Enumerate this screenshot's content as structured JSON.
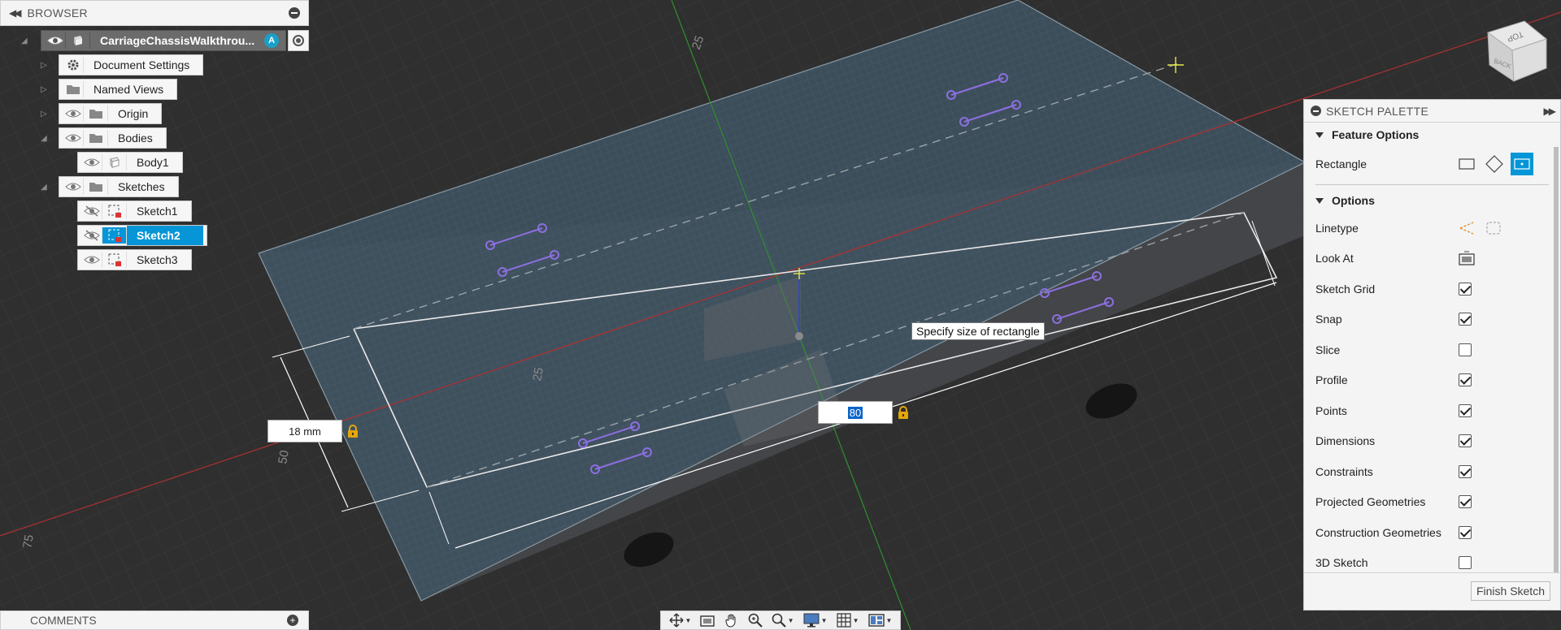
{
  "browser": {
    "title": "BROWSER",
    "root": {
      "label": "CarriageChassisWalkthrou...",
      "badge": "A"
    },
    "items": [
      {
        "label": "Document Settings"
      },
      {
        "label": "Named Views"
      },
      {
        "label": "Origin"
      },
      {
        "label": "Bodies"
      },
      {
        "label": "Body1"
      },
      {
        "label": "Sketches"
      },
      {
        "label": "Sketch1"
      },
      {
        "label": "Sketch2",
        "selected": true
      },
      {
        "label": "Sketch3"
      }
    ]
  },
  "comments": {
    "title": "COMMENTS"
  },
  "sketch_palette": {
    "title": "SKETCH PALETTE",
    "feature_options": {
      "title": "Feature Options",
      "rectangle_label": "Rectangle"
    },
    "options": {
      "title": "Options",
      "rows": [
        {
          "label": "Linetype"
        },
        {
          "label": "Look At"
        },
        {
          "label": "Sketch Grid",
          "checked": true
        },
        {
          "label": "Snap",
          "checked": true
        },
        {
          "label": "Slice",
          "checked": false
        },
        {
          "label": "Profile",
          "checked": true
        },
        {
          "label": "Points",
          "checked": true
        },
        {
          "label": "Dimensions",
          "checked": true
        },
        {
          "label": "Constraints",
          "checked": true
        },
        {
          "label": "Projected Geometries",
          "checked": true
        },
        {
          "label": "Construction Geometries",
          "checked": true
        },
        {
          "label": "3D Sketch",
          "checked": false
        }
      ]
    },
    "finish_label": "Finish Sketch"
  },
  "canvas": {
    "height_input": "18 mm",
    "width_input": "80",
    "tooltip": "Specify size of rectangle",
    "axis_labels": [
      "25",
      "25",
      "50",
      "75"
    ],
    "viewcube": {
      "top": "TOP",
      "back": "BACK"
    }
  },
  "colors": {
    "accent": "#0696d7",
    "sketch_line": "#8c6fe0",
    "lock": "#e4a70a",
    "x_axis": "#b03030",
    "y_axis": "#2f8f2f"
  }
}
